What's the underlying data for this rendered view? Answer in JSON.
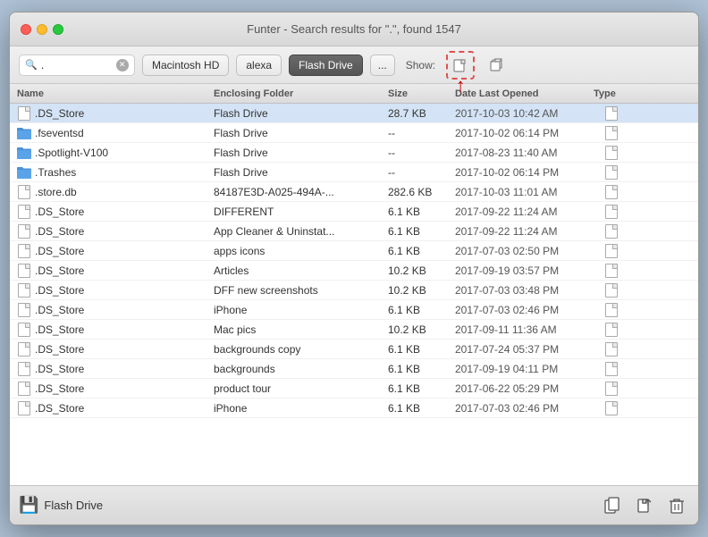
{
  "window": {
    "title": "Funter - Search results for \".\", found 1547"
  },
  "toolbar": {
    "search_value": ".",
    "search_placeholder": ".",
    "disk_buttons": [
      {
        "label": "Macintosh HD",
        "active": false
      },
      {
        "label": "alexa",
        "active": false
      },
      {
        "label": "Flash Drive",
        "active": true
      }
    ],
    "ellipsis_label": "...",
    "show_label": "Show:"
  },
  "columns": {
    "name": "Name",
    "folder": "Enclosing Folder",
    "size": "Size",
    "date": "Date Last Opened",
    "type": "Type"
  },
  "files": [
    {
      "name": ".DS_Store",
      "folder": "Flash Drive",
      "size": "28.7 KB",
      "date": "2017-10-03 10:42 AM",
      "type": "file",
      "icon": "file"
    },
    {
      "name": ".fseventsd",
      "folder": "Flash Drive",
      "size": "--",
      "date": "2017-10-02 06:14 PM",
      "type": "file",
      "icon": "folder"
    },
    {
      "name": ".Spotlight-V100",
      "folder": "Flash Drive",
      "size": "--",
      "date": "2017-08-23 11:40 AM",
      "type": "file",
      "icon": "folder"
    },
    {
      "name": ".Trashes",
      "folder": "Flash Drive",
      "size": "--",
      "date": "2017-10-02 06:14 PM",
      "type": "file",
      "icon": "folder"
    },
    {
      "name": ".store.db",
      "folder": "84187E3D-A025-494A-...",
      "size": "282.6 KB",
      "date": "2017-10-03 11:01 AM",
      "type": "file",
      "icon": "file"
    },
    {
      "name": ".DS_Store",
      "folder": "DIFFERENT",
      "size": "6.1 KB",
      "date": "2017-09-22 11:24 AM",
      "type": "file",
      "icon": "file"
    },
    {
      "name": ".DS_Store",
      "folder": "App Cleaner & Uninstat...",
      "size": "6.1 KB",
      "date": "2017-09-22 11:24 AM",
      "type": "file",
      "icon": "file"
    },
    {
      "name": ".DS_Store",
      "folder": "apps icons",
      "size": "6.1 KB",
      "date": "2017-07-03 02:50 PM",
      "type": "file",
      "icon": "file"
    },
    {
      "name": ".DS_Store",
      "folder": "Articles",
      "size": "10.2 KB",
      "date": "2017-09-19 03:57 PM",
      "type": "file",
      "icon": "file"
    },
    {
      "name": ".DS_Store",
      "folder": "DFF new screenshots",
      "size": "10.2 KB",
      "date": "2017-07-03 03:48 PM",
      "type": "file",
      "icon": "file"
    },
    {
      "name": ".DS_Store",
      "folder": "iPhone",
      "size": "6.1 KB",
      "date": "2017-07-03 02:46 PM",
      "type": "file",
      "icon": "file"
    },
    {
      "name": ".DS_Store",
      "folder": "Mac pics",
      "size": "10.2 KB",
      "date": "2017-09-11 11:36 AM",
      "type": "file",
      "icon": "file"
    },
    {
      "name": ".DS_Store",
      "folder": "backgrounds copy",
      "size": "6.1 KB",
      "date": "2017-07-24 05:37 PM",
      "type": "file",
      "icon": "file"
    },
    {
      "name": ".DS_Store",
      "folder": "backgrounds",
      "size": "6.1 KB",
      "date": "2017-09-19 04:11 PM",
      "type": "file",
      "icon": "file"
    },
    {
      "name": ".DS_Store",
      "folder": "product tour",
      "size": "6.1 KB",
      "date": "2017-06-22 05:29 PM",
      "type": "file",
      "icon": "file"
    },
    {
      "name": ".DS_Store",
      "folder": "iPhone",
      "size": "6.1 KB",
      "date": "2017-07-03 02:46 PM",
      "type": "file",
      "icon": "file"
    }
  ],
  "statusbar": {
    "drive_name": "Flash Drive"
  },
  "icons": {
    "search": "🔍",
    "clear": "✕",
    "folder": "📁",
    "file_reveal": "↑",
    "cube": "⬜",
    "copy": "⎘",
    "reveal_in_finder": "↑",
    "trash": "🗑"
  }
}
